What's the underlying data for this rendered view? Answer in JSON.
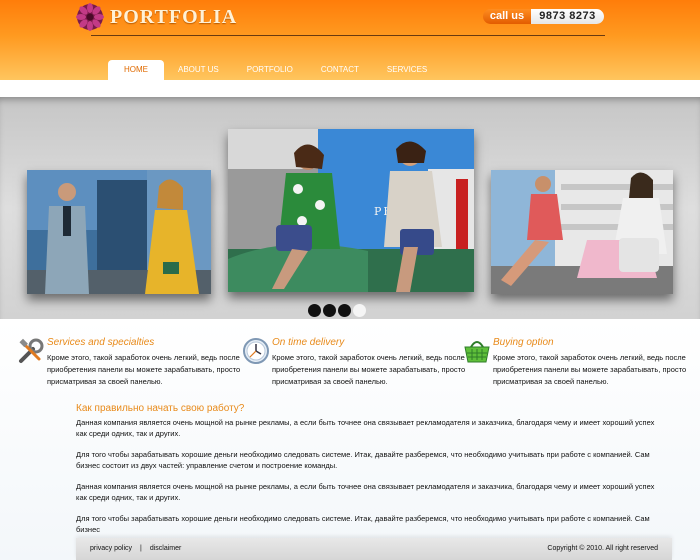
{
  "header": {
    "logo_text": "PORTFOLIA",
    "call_label": "call us",
    "phone": "9873 8273"
  },
  "nav": {
    "items": [
      {
        "label": "HOME",
        "active": true
      },
      {
        "label": "ABOUT US",
        "active": false
      },
      {
        "label": "PORTFOLIO",
        "active": false
      },
      {
        "label": "CONTACT",
        "active": false
      },
      {
        "label": "SERVICES",
        "active": false
      }
    ]
  },
  "slider": {
    "center_sign": "PRADA",
    "dots": [
      {
        "active": true
      },
      {
        "active": true
      },
      {
        "active": true
      },
      {
        "active": false
      }
    ]
  },
  "features": [
    {
      "icon": "tools-icon",
      "title": "Services and specialties",
      "text": "Кроме этого, такой заработок очень легкий, ведь после приобретения панели вы можете зарабатывать, просто присматривая за своей панелью."
    },
    {
      "icon": "clock-icon",
      "title": "On time delivery",
      "text": "Кроме этого, такой заработок очень легкий, ведь после приобретения панели вы можете зарабатывать, просто присматривая за своей панелью."
    },
    {
      "icon": "basket-icon",
      "title": "Buying option",
      "text": "Кроме этого, такой заработок очень легкий, ведь после приобретения панели вы можете зарабатывать, просто присматривая за своей панелью."
    }
  ],
  "article": {
    "title": "Как правильно начать свою работу?",
    "paragraphs": [
      "Данная компания является очень мощной на рынке рекламы, а если быть точнее она связывает рекламодателя и заказчика, благодаря чему и имеет хороший успех как среди одних, так и других.",
      "Для того чтобы зарабатывать хорошие деньги необходимо следовать системе. Итак, давайте разберемся, что необходимо учитывать при работе с компанией. Сам бизнес состоит из двух частей: управление счетом и построение команды.",
      "Данная компания является очень мощной на рынке рекламы, а если быть точнее она связывает рекламодателя и заказчика, благодаря чему и имеет хороший успех как среди одних, так и других.",
      "Для того чтобы зарабатывать хорошие деньги необходимо следовать системе. Итак, давайте разберемся, что необходимо учитывать при работе с компанией. Сам бизнес"
    ]
  },
  "footer": {
    "link_privacy": "privacy policy",
    "separator": "|",
    "link_disclaimer": "disclaimer",
    "copyright": "Copyright © 2010. All right reserved"
  },
  "colors": {
    "brand_orange": "#ff8a10",
    "heading_orange": "#e88a1a"
  }
}
